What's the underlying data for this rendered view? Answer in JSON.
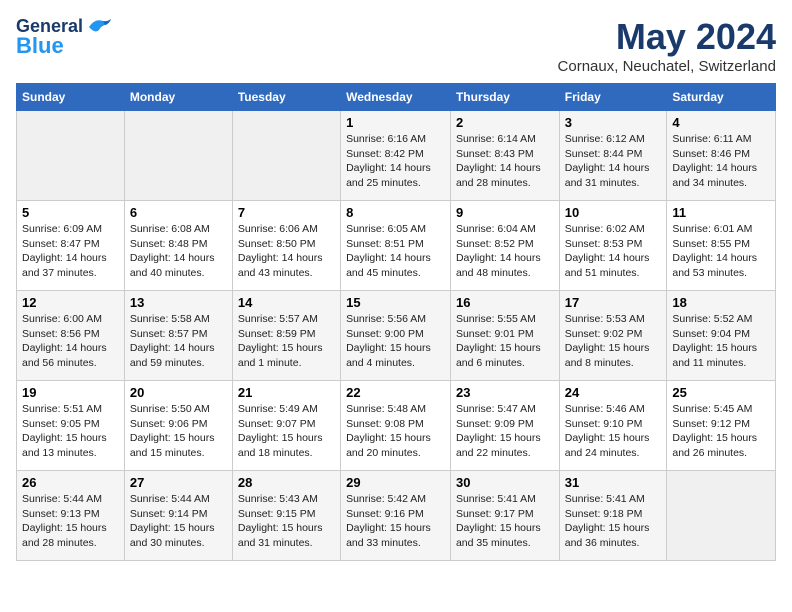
{
  "header": {
    "logo_line1": "General",
    "logo_line2": "Blue",
    "month": "May 2024",
    "location": "Cornaux, Neuchatel, Switzerland"
  },
  "days_of_week": [
    "Sunday",
    "Monday",
    "Tuesday",
    "Wednesday",
    "Thursday",
    "Friday",
    "Saturday"
  ],
  "weeks": [
    [
      {
        "day": "",
        "info": ""
      },
      {
        "day": "",
        "info": ""
      },
      {
        "day": "",
        "info": ""
      },
      {
        "day": "1",
        "info": "Sunrise: 6:16 AM\nSunset: 8:42 PM\nDaylight: 14 hours\nand 25 minutes."
      },
      {
        "day": "2",
        "info": "Sunrise: 6:14 AM\nSunset: 8:43 PM\nDaylight: 14 hours\nand 28 minutes."
      },
      {
        "day": "3",
        "info": "Sunrise: 6:12 AM\nSunset: 8:44 PM\nDaylight: 14 hours\nand 31 minutes."
      },
      {
        "day": "4",
        "info": "Sunrise: 6:11 AM\nSunset: 8:46 PM\nDaylight: 14 hours\nand 34 minutes."
      }
    ],
    [
      {
        "day": "5",
        "info": "Sunrise: 6:09 AM\nSunset: 8:47 PM\nDaylight: 14 hours\nand 37 minutes."
      },
      {
        "day": "6",
        "info": "Sunrise: 6:08 AM\nSunset: 8:48 PM\nDaylight: 14 hours\nand 40 minutes."
      },
      {
        "day": "7",
        "info": "Sunrise: 6:06 AM\nSunset: 8:50 PM\nDaylight: 14 hours\nand 43 minutes."
      },
      {
        "day": "8",
        "info": "Sunrise: 6:05 AM\nSunset: 8:51 PM\nDaylight: 14 hours\nand 45 minutes."
      },
      {
        "day": "9",
        "info": "Sunrise: 6:04 AM\nSunset: 8:52 PM\nDaylight: 14 hours\nand 48 minutes."
      },
      {
        "day": "10",
        "info": "Sunrise: 6:02 AM\nSunset: 8:53 PM\nDaylight: 14 hours\nand 51 minutes."
      },
      {
        "day": "11",
        "info": "Sunrise: 6:01 AM\nSunset: 8:55 PM\nDaylight: 14 hours\nand 53 minutes."
      }
    ],
    [
      {
        "day": "12",
        "info": "Sunrise: 6:00 AM\nSunset: 8:56 PM\nDaylight: 14 hours\nand 56 minutes."
      },
      {
        "day": "13",
        "info": "Sunrise: 5:58 AM\nSunset: 8:57 PM\nDaylight: 14 hours\nand 59 minutes."
      },
      {
        "day": "14",
        "info": "Sunrise: 5:57 AM\nSunset: 8:59 PM\nDaylight: 15 hours\nand 1 minute."
      },
      {
        "day": "15",
        "info": "Sunrise: 5:56 AM\nSunset: 9:00 PM\nDaylight: 15 hours\nand 4 minutes."
      },
      {
        "day": "16",
        "info": "Sunrise: 5:55 AM\nSunset: 9:01 PM\nDaylight: 15 hours\nand 6 minutes."
      },
      {
        "day": "17",
        "info": "Sunrise: 5:53 AM\nSunset: 9:02 PM\nDaylight: 15 hours\nand 8 minutes."
      },
      {
        "day": "18",
        "info": "Sunrise: 5:52 AM\nSunset: 9:04 PM\nDaylight: 15 hours\nand 11 minutes."
      }
    ],
    [
      {
        "day": "19",
        "info": "Sunrise: 5:51 AM\nSunset: 9:05 PM\nDaylight: 15 hours\nand 13 minutes."
      },
      {
        "day": "20",
        "info": "Sunrise: 5:50 AM\nSunset: 9:06 PM\nDaylight: 15 hours\nand 15 minutes."
      },
      {
        "day": "21",
        "info": "Sunrise: 5:49 AM\nSunset: 9:07 PM\nDaylight: 15 hours\nand 18 minutes."
      },
      {
        "day": "22",
        "info": "Sunrise: 5:48 AM\nSunset: 9:08 PM\nDaylight: 15 hours\nand 20 minutes."
      },
      {
        "day": "23",
        "info": "Sunrise: 5:47 AM\nSunset: 9:09 PM\nDaylight: 15 hours\nand 22 minutes."
      },
      {
        "day": "24",
        "info": "Sunrise: 5:46 AM\nSunset: 9:10 PM\nDaylight: 15 hours\nand 24 minutes."
      },
      {
        "day": "25",
        "info": "Sunrise: 5:45 AM\nSunset: 9:12 PM\nDaylight: 15 hours\nand 26 minutes."
      }
    ],
    [
      {
        "day": "26",
        "info": "Sunrise: 5:44 AM\nSunset: 9:13 PM\nDaylight: 15 hours\nand 28 minutes."
      },
      {
        "day": "27",
        "info": "Sunrise: 5:44 AM\nSunset: 9:14 PM\nDaylight: 15 hours\nand 30 minutes."
      },
      {
        "day": "28",
        "info": "Sunrise: 5:43 AM\nSunset: 9:15 PM\nDaylight: 15 hours\nand 31 minutes."
      },
      {
        "day": "29",
        "info": "Sunrise: 5:42 AM\nSunset: 9:16 PM\nDaylight: 15 hours\nand 33 minutes."
      },
      {
        "day": "30",
        "info": "Sunrise: 5:41 AM\nSunset: 9:17 PM\nDaylight: 15 hours\nand 35 minutes."
      },
      {
        "day": "31",
        "info": "Sunrise: 5:41 AM\nSunset: 9:18 PM\nDaylight: 15 hours\nand 36 minutes."
      },
      {
        "day": "",
        "info": ""
      }
    ]
  ]
}
